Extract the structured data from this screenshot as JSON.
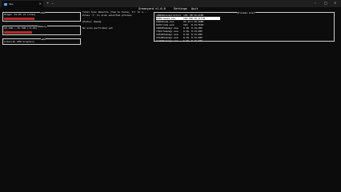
{
  "window": {
    "tab_title": "dev",
    "tab_close": "×",
    "new_tab": "+",
    "dropdown": "⌄",
    "minimize": "–",
    "maximize": "□",
    "close": "×"
  },
  "app": {
    "title": "Greenyard v1.0.0",
    "menu": [
      "Settings",
      "Quit"
    ]
  },
  "cpu_panel": {
    "title": "CPU",
    "label": "Usage: 91.0% (4 cores)",
    "usage_fraction": 0.4
  },
  "memory_panel": {
    "title": "Memory",
    "label": "10.7GB / 15.7GB (71.0%)",
    "usage_fraction": 0.36
  },
  "gpu_panel": {
    "title": "GPU",
    "label": "Intel(R) UHD Graphics"
  },
  "scan_panel": {
    "header": "Total Scan Results (Tab to Focus, T/↑ to s...",
    "hint": "Press 't' to scan selected process",
    "status": "Status: Ready",
    "result": "No scan performed yet"
  },
  "process_list": {
    "title": "Process List",
    "rows": [
      {
        "pid": "18884",
        "name": "VsCompileTool",
        "cpu": "190.1%",
        "mem": "0.0%",
        "res": "210M"
      },
      {
        "pid": "6080",
        "name": "vmmem.exe",
        "cpu": "100.0%",
        "mem": "0.0%",
        "res": "1171M"
      },
      {
        "pid": "20952",
        "name": "Code.exe",
        "cpu": "22.1%",
        "mem": "1.5%",
        "res": "148M"
      },
      {
        "pid": "6216",
        "name": "Code.exe",
        "cpu": "12%",
        "mem": "0.1%",
        "res": "761M"
      },
      {
        "pid": "18484",
        "name": "Taskmgr.exe",
        "cpu": "6.9%",
        "mem": "0.1%",
        "res": "43M"
      },
      {
        "pid": "7324",
        "name": "Taskmgr.exe",
        "cpu": "6.9%",
        "mem": "0.1%",
        "res": "43M"
      },
      {
        "pid": "12544",
        "name": "Taskmgr.exe",
        "cpu": "6.9%",
        "mem": "0.1%",
        "res": "43M"
      },
      {
        "pid": "15120",
        "name": "Taskmgr.exe",
        "cpu": "6.9%",
        "mem": "0.1%",
        "res": "43M"
      },
      {
        "pid": "11264",
        "name": "Taskmgr.exe",
        "cpu": "6.9%",
        "mem": "0.1%",
        "res": "44M"
      }
    ],
    "selected_index": 1
  },
  "colors": {
    "accent": "#b82b2b",
    "background": "#0c0c0c",
    "border": "#d0d0d0"
  }
}
